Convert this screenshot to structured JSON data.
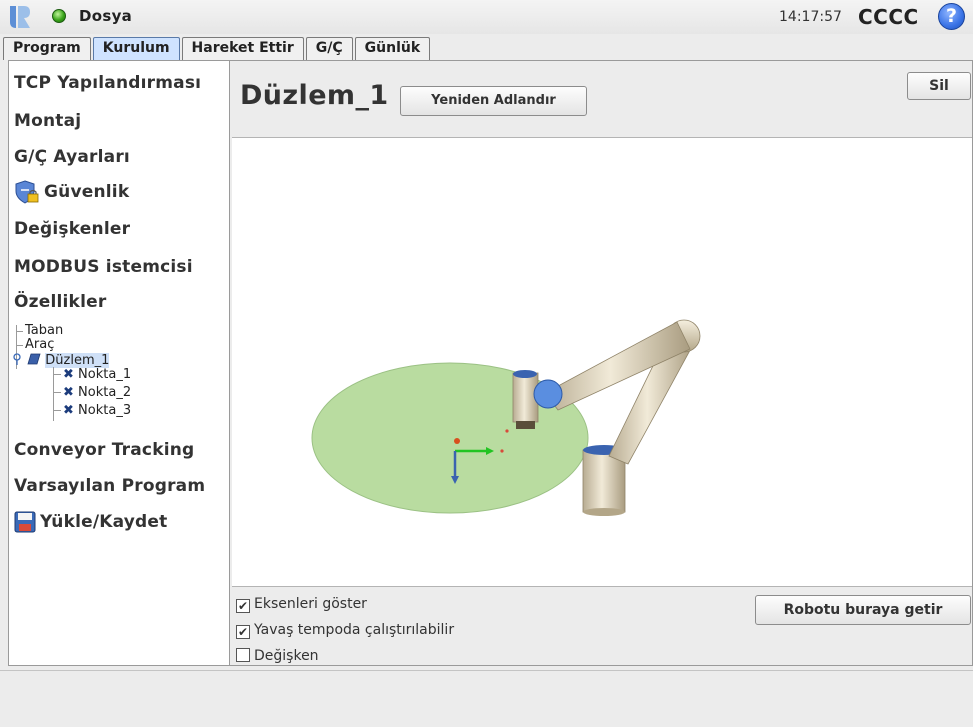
{
  "topbar": {
    "file_menu": "Dosya",
    "time": "14:17:57",
    "robot_name": "CCCC",
    "help_symbol": "?",
    "status_color": "#3aa51a"
  },
  "tabs": [
    {
      "label": "Program",
      "active": false
    },
    {
      "label": "Kurulum",
      "active": true
    },
    {
      "label": "Hareket Ettir",
      "active": false
    },
    {
      "label": "G/Ç",
      "active": false
    },
    {
      "label": "Günlük",
      "active": false
    }
  ],
  "sidebar": {
    "items": [
      {
        "label": "TCP Yapılandırması"
      },
      {
        "label": "Montaj"
      },
      {
        "label": "G/Ç Ayarları"
      },
      {
        "label": "Güvenlik",
        "icon": "shield-lock-icon"
      },
      {
        "label": "Değişkenler"
      },
      {
        "label": "MODBUS istemcisi"
      },
      {
        "label": "Özellikler"
      },
      {
        "label": "Conveyor Tracking"
      },
      {
        "label": "Varsayılan Program"
      },
      {
        "label": "Yükle/Kaydet",
        "icon": "floppy-disk-icon"
      }
    ],
    "features_tree": {
      "base": "Taban",
      "tool": "Araç",
      "plane": "Düzlem_1",
      "points": [
        "Nokta_1",
        "Nokta_2",
        "Nokta_3"
      ]
    }
  },
  "main": {
    "feature_name": "Düzlem_1",
    "rename_button": "Yeniden Adlandır",
    "delete_button": "Sil",
    "goto_button": "Robotu buraya getir",
    "options": [
      {
        "label": "Eksenleri göster",
        "checked": true
      },
      {
        "label": "Yavaş tempoda çalıştırılabilir",
        "checked": true
      },
      {
        "label": "Değişken",
        "checked": false
      }
    ]
  }
}
